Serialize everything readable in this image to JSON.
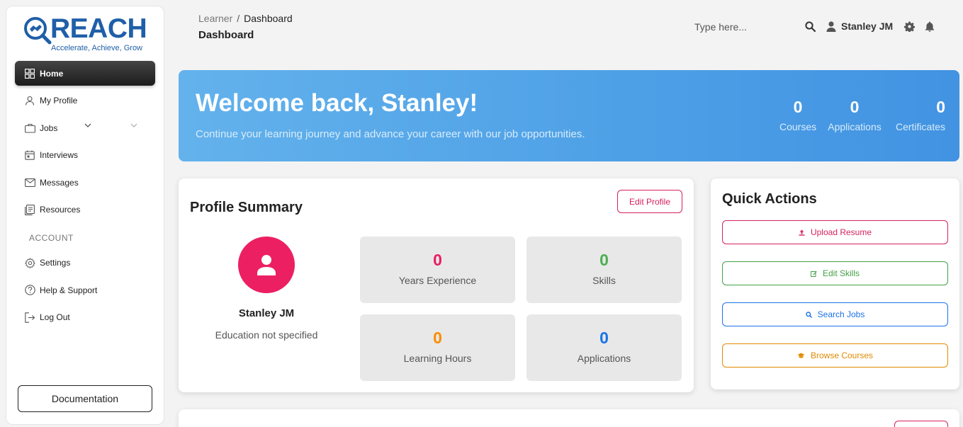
{
  "brand": {
    "name": "REACH",
    "tagline": "Accelerate, Achieve, Grow"
  },
  "sidebar": {
    "items": [
      {
        "label": "Home",
        "icon": "grid-icon",
        "active": true
      },
      {
        "label": "My Profile",
        "icon": "user-icon"
      },
      {
        "label": "Jobs",
        "icon": "briefcase-icon"
      },
      {
        "label": "Interviews",
        "icon": "calendar-icon"
      },
      {
        "label": "Messages",
        "icon": "mail-icon"
      },
      {
        "label": "Resources",
        "icon": "document-icon"
      }
    ],
    "account_heading": "ACCOUNT",
    "account_items": [
      {
        "label": "Settings",
        "icon": "gear-icon"
      },
      {
        "label": "Help & Support",
        "icon": "help-icon"
      },
      {
        "label": "Log Out",
        "icon": "logout-icon"
      }
    ],
    "documentation_label": "Documentation"
  },
  "header": {
    "breadcrumb": {
      "root": "Learner",
      "separator": "/",
      "current": "Dashboard"
    },
    "title": "Dashboard",
    "search_placeholder": "Type here...",
    "user_name": "Stanley JM"
  },
  "banner": {
    "heading": "Welcome back, Stanley!",
    "subtitle": "Continue your learning journey and advance your career with our job opportunities.",
    "stats": [
      {
        "value": "0",
        "label": "Courses"
      },
      {
        "value": "0",
        "label": "Applications"
      },
      {
        "value": "0",
        "label": "Certificates"
      }
    ]
  },
  "profile": {
    "title": "Profile Summary",
    "edit_label": "Edit Profile",
    "name": "Stanley JM",
    "education": "Education not specified",
    "metrics": [
      {
        "value": "0",
        "label": "Years Experience",
        "color": "#e91e63"
      },
      {
        "value": "0",
        "label": "Skills",
        "color": "#4caf50"
      },
      {
        "value": "0",
        "label": "Learning Hours",
        "color": "#fb8c00"
      },
      {
        "value": "0",
        "label": "Applications",
        "color": "#1a73e8"
      }
    ]
  },
  "quick_actions": {
    "title": "Quick Actions",
    "actions": [
      {
        "label": "Upload Resume",
        "icon": "upload-icon",
        "color": "#d6215f"
      },
      {
        "label": "Edit Skills",
        "icon": "edit-icon",
        "color": "#43a047"
      },
      {
        "label": "Search Jobs",
        "icon": "search-icon",
        "color": "#1a73e8"
      },
      {
        "label": "Browse Courses",
        "icon": "graduation-cap-icon",
        "color": "#e08a00"
      }
    ]
  }
}
